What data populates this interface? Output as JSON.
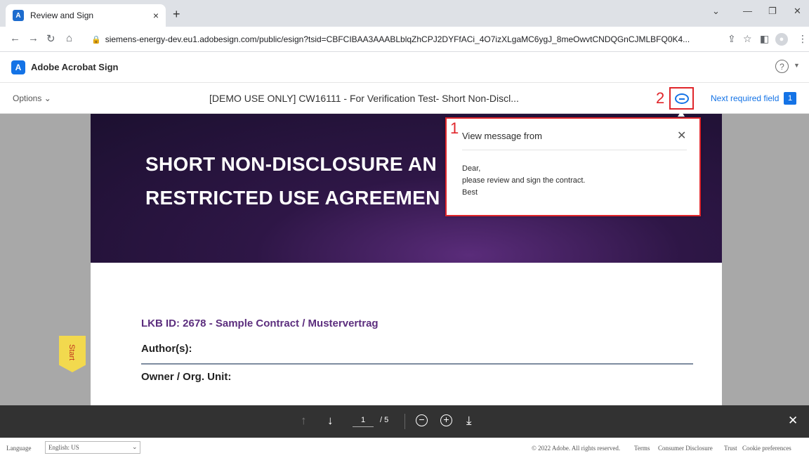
{
  "browser": {
    "tab_title": "Review and Sign",
    "tab_close": "×",
    "new_tab": "+",
    "url": "siemens-energy-dev.eu1.adobesign.com/public/esign?tsid=CBFCIBAA3AAABLblqZhCPJ2DYFfACi_4O7izXLgaMC6ygJ_8meOwvtCNDQGnCJMLBFQ0K4..."
  },
  "app": {
    "name": "Adobe Acrobat Sign"
  },
  "toolbar": {
    "options_label": "Options",
    "document_title": "[DEMO USE ONLY] CW16111 - For Verification Test- Short Non-Discl...",
    "next_required_label": "Next required field",
    "next_required_count": "1"
  },
  "annotations": {
    "label_1": "1",
    "label_2": "2"
  },
  "document": {
    "banner_line_1": "SHORT NON-DISCLOSURE AN",
    "banner_line_2": "RESTRICTED USE AGREEMEN",
    "lkb_id": "LKB ID: 2678 - Sample Contract / Mustervertrag",
    "author_label": "Author(s):",
    "owner_label": "Owner / Org. Unit:",
    "start_label": "Start"
  },
  "popup": {
    "title": "View message from",
    "line_1": "Dear,",
    "line_2": "please review and sign the contract.",
    "line_3": "Best"
  },
  "navbar": {
    "current_page": "1",
    "total_pages": "/ 5"
  },
  "footer": {
    "language_label": "Language",
    "language_value": "English: US",
    "copyright": "© 2022 Adobe. All rights reserved.",
    "terms": "Terms",
    "consumer_disclosure": "Consumer Disclosure",
    "trust": "Trust",
    "cookie_preferences": "Cookie preferences"
  },
  "colors": {
    "accent": "#1473e6",
    "annotation_red": "#e0262b",
    "banner_purple": "#2e1646",
    "nav_dark": "#323232"
  }
}
